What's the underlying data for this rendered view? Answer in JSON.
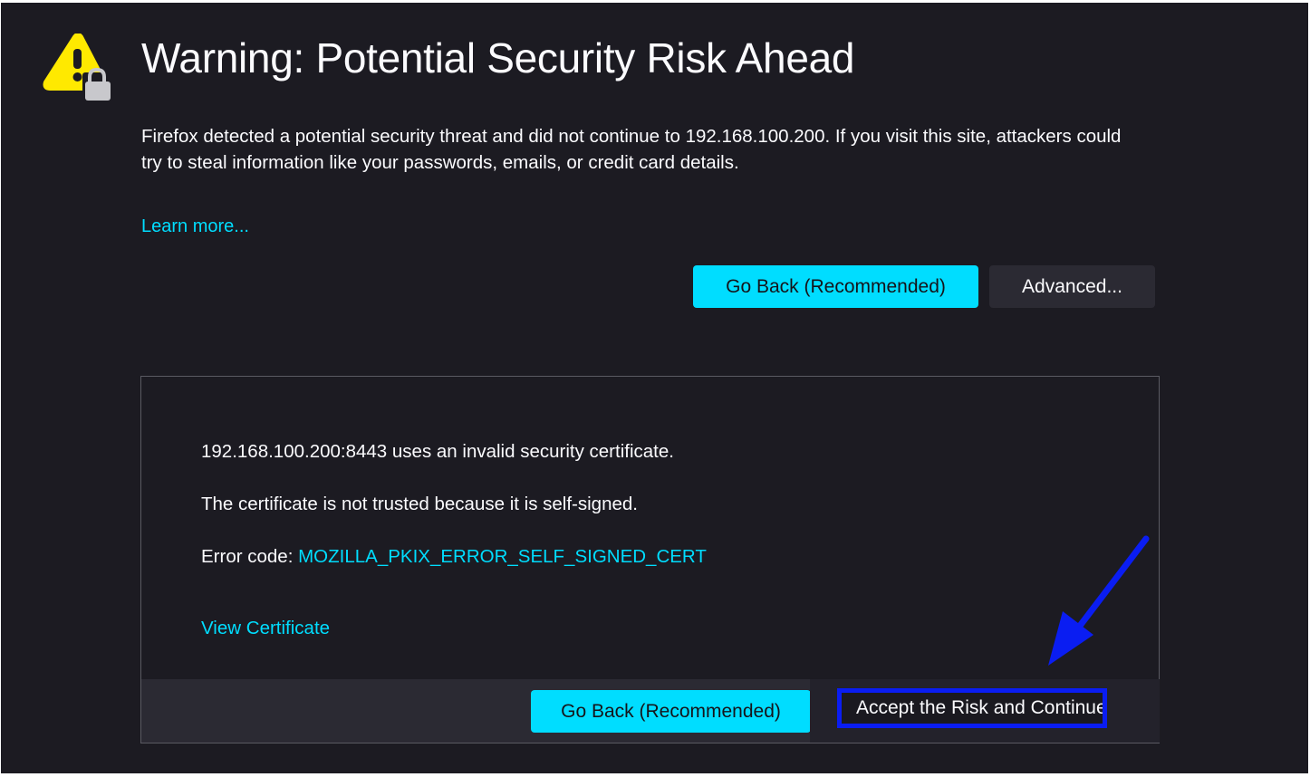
{
  "page": {
    "title": "Warning: Potential Security Risk Ahead",
    "description": "Firefox detected a potential security threat and did not continue to 192.168.100.200. If you visit this site, attackers could try to steal information like your passwords, emails, or credit card details.",
    "learn_more": "Learn more...",
    "go_back_label": "Go Back (Recommended)",
    "advanced_label": "Advanced..."
  },
  "advanced_panel": {
    "line_invalid_cert": "192.168.100.200:8443 uses an invalid security certificate.",
    "line_self_signed": "The certificate is not trusted because it is self-signed.",
    "error_code_prefix": "Error code: ",
    "error_code": "MOZILLA_PKIX_ERROR_SELF_SIGNED_CERT",
    "view_certificate": "View Certificate",
    "go_back_label": "Go Back (Recommended)",
    "accept_label": "Accept the Risk and Continue"
  },
  "icons": {
    "warning": "warning-triangle-with-lock-icon",
    "annotation": "blue-arrow-icon"
  },
  "colors": {
    "background": "#1c1b22",
    "accent": "#00ddff",
    "warning_yellow": "#ffe900",
    "annotation_blue": "#0a1df2"
  }
}
